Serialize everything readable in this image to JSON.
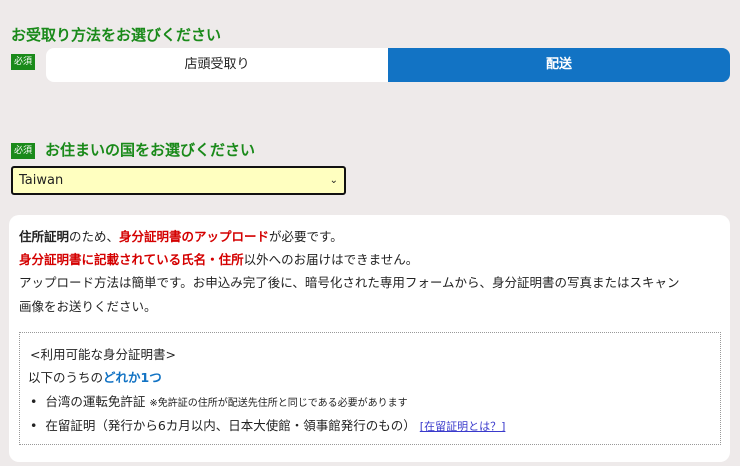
{
  "receive": {
    "title": "お受取り方法をお選びください",
    "badge": "必須",
    "options": [
      "店頭受取り",
      "配送"
    ],
    "selected": "配送"
  },
  "country": {
    "title": "お住まいの国をお選びください",
    "badge": "必須",
    "value": "Taiwan"
  },
  "notice": {
    "l1a": "住所証明",
    "l1b": "のため、",
    "l1c": "身分証明書のアップロード",
    "l1d": "が必要です。",
    "l2a": "身分証明書に記載されている氏名・住所",
    "l2b": "以外へのお届けはできません。",
    "l3": "アップロード方法は簡単です。お申込み完了後に、暗号化された専用フォームから、身分証明書の写真またはスキャン",
    "l4": "画像をお送りください。"
  },
  "ids": {
    "heading": "<利用可能な身分証明書>",
    "sub_a": "以下のうちの",
    "sub_b": "どれか1つ",
    "items": [
      {
        "text": "台湾の運転免許証",
        "note": "※免許証の住所が配送先住所と同じである必要があります"
      },
      {
        "text": "在留証明（発行から6カ月以内、日本大使館・領事館発行のもの）",
        "link": "[在留証明とは？]"
      }
    ]
  },
  "colors": {
    "green": "#1a8a1a",
    "blue": "#1273c4",
    "red": "#d40000"
  }
}
